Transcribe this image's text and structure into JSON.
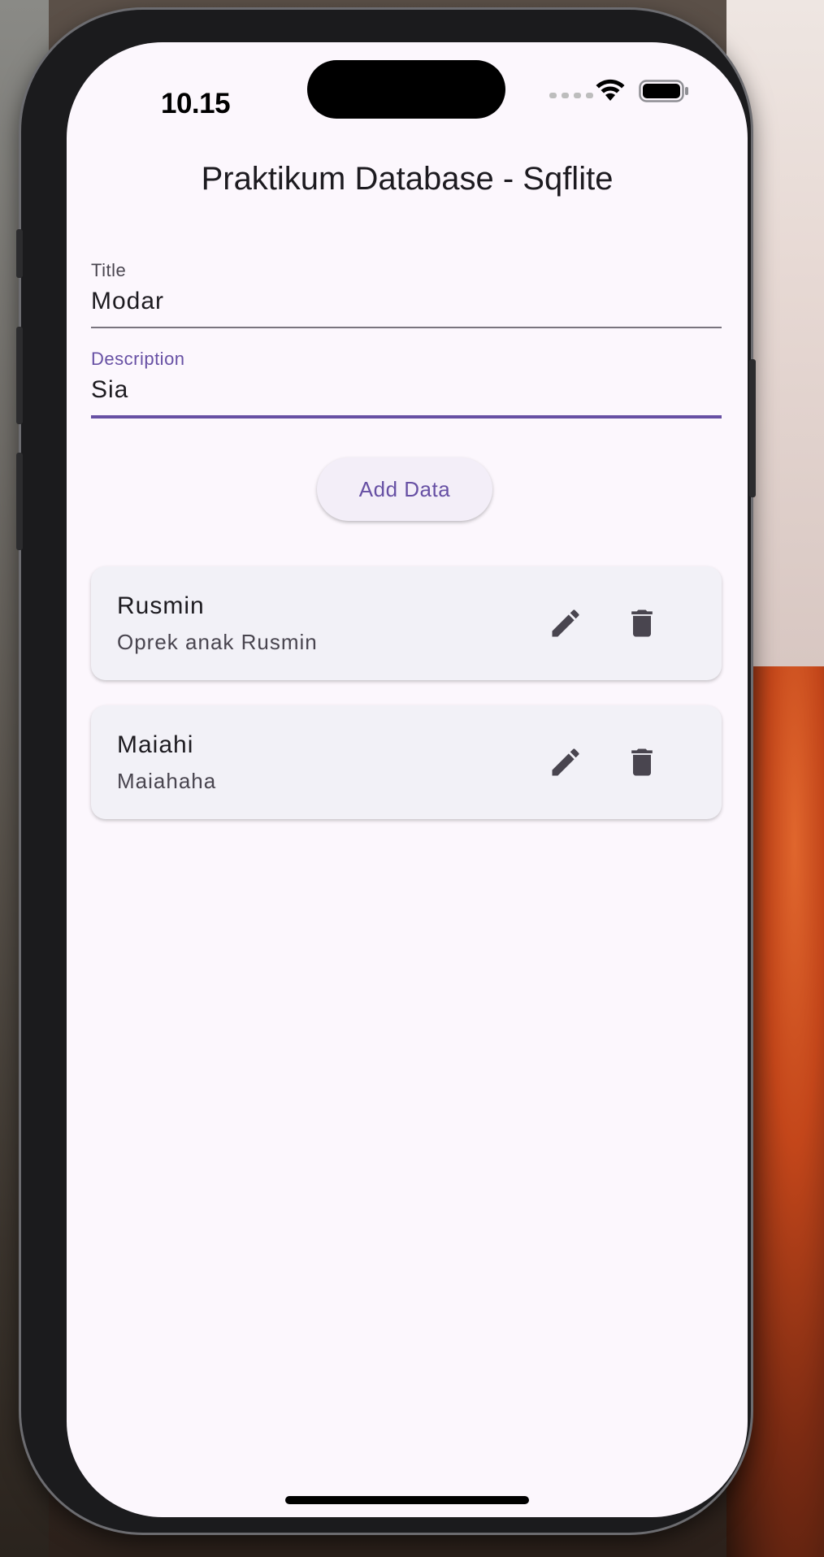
{
  "status_bar": {
    "time": "10.15"
  },
  "app": {
    "title": "Praktikum Database - Sqflite"
  },
  "form": {
    "title_label": "Title",
    "title_value": "Modar",
    "description_label": "Description",
    "description_value": "Sia",
    "add_button_label": "Add Data"
  },
  "items": [
    {
      "title": "Rusmin",
      "description": "Oprek anak Rusmin"
    },
    {
      "title": "Maiahi",
      "description": "Maiahaha"
    }
  ],
  "icons": {
    "edit": "edit-icon",
    "delete": "delete-icon",
    "wifi": "wifi-icon",
    "battery": "battery-icon"
  },
  "colors": {
    "accent": "#6750a4",
    "screen_background": "#fcf7fd",
    "card_background": "#f2f1f7"
  }
}
